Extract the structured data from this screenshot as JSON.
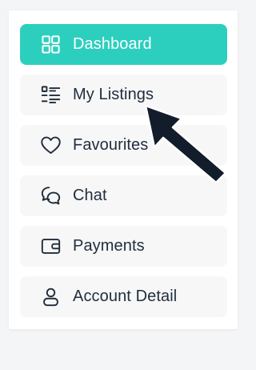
{
  "colors": {
    "accent": "#2ccfbe",
    "text": "#1f2d3d",
    "item_bg": "#f7f7f7",
    "arrow": "#121c2b"
  },
  "sidebar": {
    "items": [
      {
        "label": "Dashboard",
        "icon": "dashboard-grid-icon",
        "active": true
      },
      {
        "label": "My Listings",
        "icon": "list-icon",
        "active": false
      },
      {
        "label": "Favourites",
        "icon": "heart-icon",
        "active": false
      },
      {
        "label": "Chat",
        "icon": "chat-bubbles-icon",
        "active": false
      },
      {
        "label": "Payments",
        "icon": "wallet-icon",
        "active": false
      },
      {
        "label": "Account Detail",
        "icon": "user-icon",
        "active": false
      }
    ]
  },
  "annotation": {
    "icon": "pointer-arrow-icon"
  }
}
